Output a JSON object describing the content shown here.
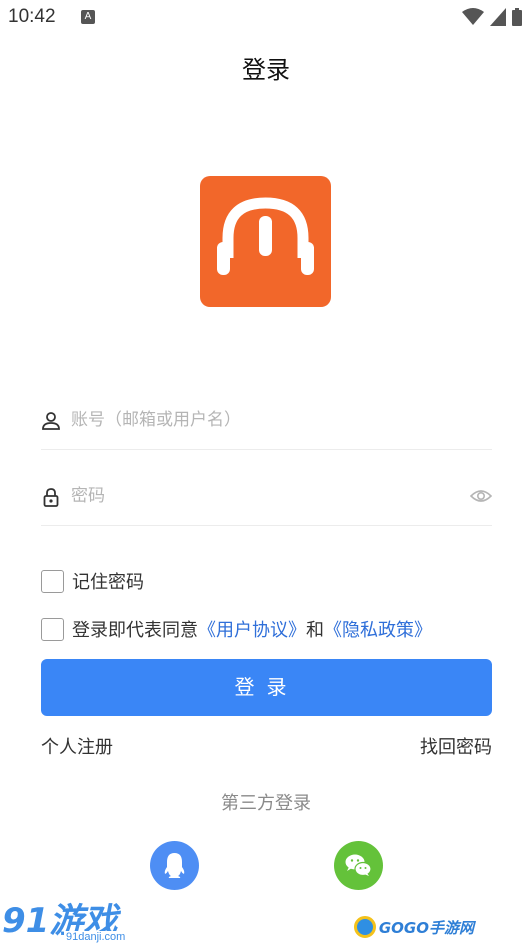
{
  "status_bar": {
    "time": "10:42",
    "notification_badge": "A",
    "icons": [
      "wifi-icon",
      "signal-icon",
      "battery-icon"
    ]
  },
  "header": {
    "title": "登录"
  },
  "logo": {
    "icon": "headphones-logo-icon",
    "color": "#f2672a"
  },
  "form": {
    "account_placeholder": "账号（邮箱或用户名）",
    "account_value": "",
    "password_placeholder": "密码",
    "password_value": "",
    "remember_label": "记住密码",
    "remember_checked": false,
    "agree_checked": false,
    "agree_prefix": "登录即代表同意",
    "user_agreement": "《用户协议》",
    "agree_and": "和",
    "privacy_policy": "《隐私政策》"
  },
  "actions": {
    "login_label": "登录",
    "register_label": "个人注册",
    "forgot_label": "找回密码"
  },
  "third_party": {
    "title": "第三方登录",
    "qq_color": "#4e8ef4",
    "wechat_color": "#64c23a"
  },
  "watermarks": {
    "left_big": "91游戏",
    "left_sub": "91danji.com",
    "right": "GOGO手游网"
  },
  "colors": {
    "primary": "#3a86f6",
    "link": "#2f6fd9"
  }
}
